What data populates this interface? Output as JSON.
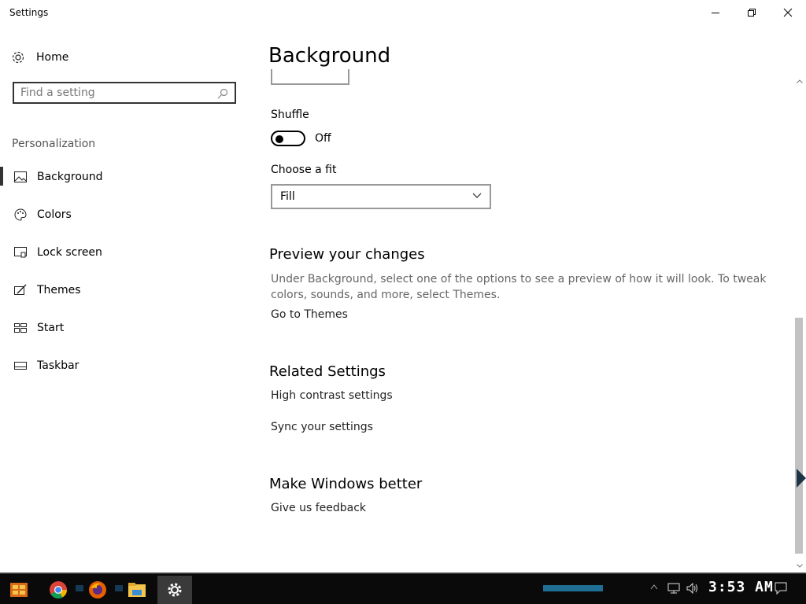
{
  "window": {
    "title": "Settings"
  },
  "nav": {
    "home_label": "Home",
    "search_placeholder": "Find a setting",
    "section_label": "Personalization",
    "items": [
      {
        "label": "Background",
        "icon": "image-icon",
        "active": true
      },
      {
        "label": "Colors",
        "icon": "palette-icon",
        "active": false
      },
      {
        "label": "Lock screen",
        "icon": "lock-screen-icon",
        "active": false
      },
      {
        "label": "Themes",
        "icon": "brush-icon",
        "active": false
      },
      {
        "label": "Start",
        "icon": "start-icon",
        "active": false
      },
      {
        "label": "Taskbar",
        "icon": "taskbar-icon",
        "active": false
      }
    ]
  },
  "main": {
    "title": "Background",
    "shuffle": {
      "label": "Shuffle",
      "state": "Off"
    },
    "fit": {
      "label": "Choose a fit",
      "value": "Fill"
    },
    "preview": {
      "heading": "Preview your changes",
      "description": "Under Background, select one of the options to see a preview of how it will look. To tweak colors, sounds, and more, select Themes.",
      "link": "Go to Themes"
    },
    "related": {
      "heading": "Related Settings",
      "links": [
        "High contrast settings",
        "Sync your settings"
      ]
    },
    "better": {
      "heading": "Make Windows better",
      "link": "Give us feedback"
    }
  },
  "taskbar": {
    "clock": "3:53 AM",
    "apps": [
      "start-icon",
      "chrome-icon",
      "firefox-icon",
      "file-explorer-icon",
      "settings-gear-icon"
    ]
  }
}
